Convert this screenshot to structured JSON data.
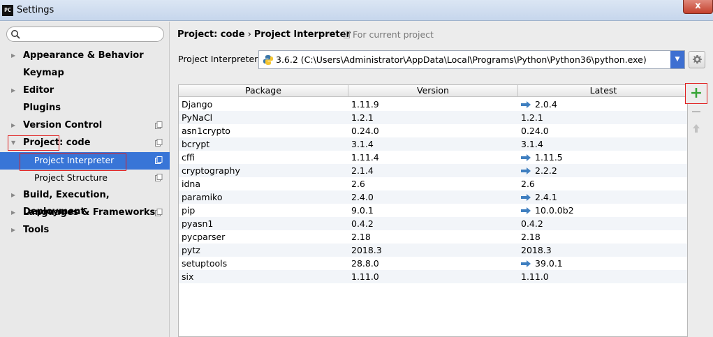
{
  "window": {
    "app_logo": "PC",
    "title": "Settings",
    "close_label": "x"
  },
  "sidebar": {
    "search_placeholder": "",
    "items": [
      {
        "label": "Appearance & Behavior"
      },
      {
        "label": "Keymap"
      },
      {
        "label": "Editor"
      },
      {
        "label": "Plugins"
      },
      {
        "label": "Version Control"
      },
      {
        "label": "Project: code"
      },
      {
        "label": "Project Interpreter"
      },
      {
        "label": "Project Structure"
      },
      {
        "label": "Build, Execution, Deployment"
      },
      {
        "label": "Languages & Frameworks"
      },
      {
        "label": "Tools"
      }
    ]
  },
  "main": {
    "breadcrumb": {
      "parent": "Project: code",
      "separator": "›",
      "current": "Project Interpreter"
    },
    "for_current_project": "For current project",
    "interpreter_label": "Project Interpreter:",
    "interpreter_value": "3.6.2 (C:\\Users\\Administrator\\AppData\\Local\\Programs\\Python\\Python36\\python.exe)",
    "table": {
      "columns": [
        "Package",
        "Version",
        "Latest"
      ],
      "rows": [
        {
          "package": "Django",
          "version": "1.11.9",
          "latest": "2.0.4",
          "upgrade": true
        },
        {
          "package": "PyNaCl",
          "version": "1.2.1",
          "latest": "1.2.1",
          "upgrade": false
        },
        {
          "package": "asn1crypto",
          "version": "0.24.0",
          "latest": "0.24.0",
          "upgrade": false
        },
        {
          "package": "bcrypt",
          "version": "3.1.4",
          "latest": "3.1.4",
          "upgrade": false
        },
        {
          "package": "cffi",
          "version": "1.11.4",
          "latest": "1.11.5",
          "upgrade": true
        },
        {
          "package": "cryptography",
          "version": "2.1.4",
          "latest": "2.2.2",
          "upgrade": true
        },
        {
          "package": "idna",
          "version": "2.6",
          "latest": "2.6",
          "upgrade": false
        },
        {
          "package": "paramiko",
          "version": "2.4.0",
          "latest": "2.4.1",
          "upgrade": true
        },
        {
          "package": "pip",
          "version": "9.0.1",
          "latest": "10.0.0b2",
          "upgrade": true
        },
        {
          "package": "pyasn1",
          "version": "0.4.2",
          "latest": "0.4.2",
          "upgrade": false
        },
        {
          "package": "pycparser",
          "version": "2.18",
          "latest": "2.18",
          "upgrade": false
        },
        {
          "package": "pytz",
          "version": "2018.3",
          "latest": "2018.3",
          "upgrade": false
        },
        {
          "package": "setuptools",
          "version": "28.8.0",
          "latest": "39.0.1",
          "upgrade": true
        },
        {
          "package": "six",
          "version": "1.11.0",
          "latest": "1.11.0",
          "upgrade": false
        }
      ]
    },
    "toolbar": {
      "add_label": "+"
    }
  },
  "colors": {
    "selection": "#3875d7",
    "highlight_box": "#e02020",
    "add_green": "#3aa53a",
    "upgrade_arrow": "#3f7fc0"
  },
  "icons": [
    "search-icon",
    "project-scope-icon",
    "python-icon",
    "dropdown-arrow-icon",
    "gear-icon",
    "upgrade-arrow-icon",
    "add-icon",
    "remove-icon",
    "upgrade-icon"
  ]
}
